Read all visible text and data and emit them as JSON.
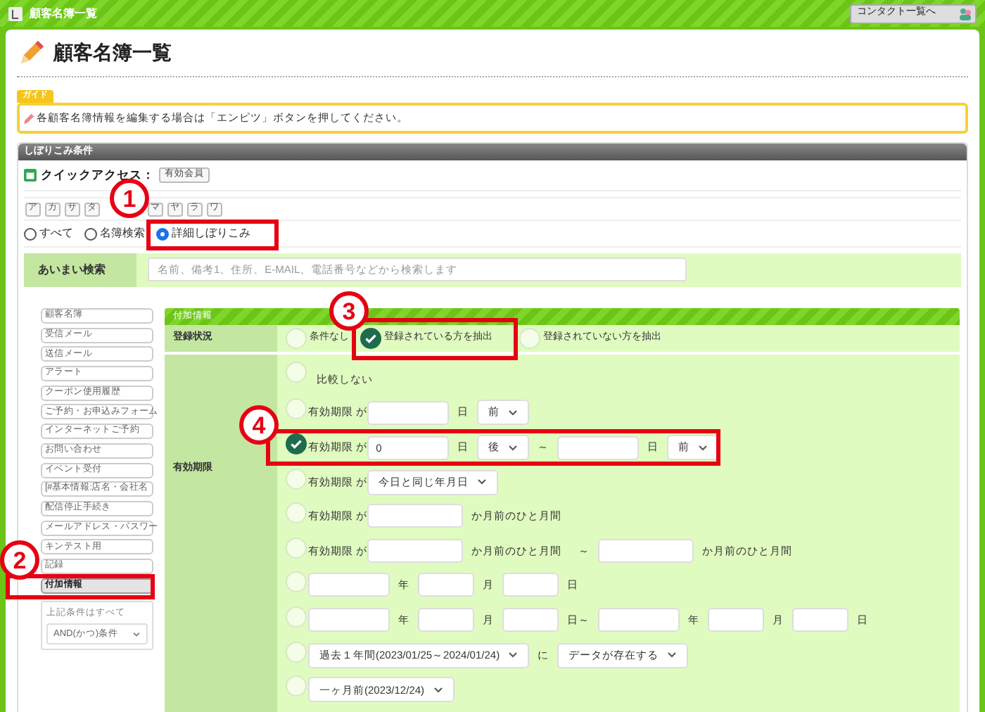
{
  "window": {
    "title": "顧客名簿一覧",
    "contact_button": "コンタクト一覧へ"
  },
  "heading": "顧客名簿一覧",
  "guide": {
    "tag": "ガイド",
    "text": "各顧客名簿情報を編集する場合は「エンピツ」ボタンを押してください。"
  },
  "filter": {
    "title": "しぼりこみ条件",
    "quick_access_label": "クイックアクセス：",
    "quick_access_buttons": [
      "有効会員"
    ],
    "kana": [
      "ア",
      "カ",
      "サ",
      "タ",
      "マ",
      "ヤ",
      "ラ",
      "ワ"
    ],
    "modes": [
      {
        "label": "すべて",
        "selected": false
      },
      {
        "label": "名簿検索",
        "selected": false
      },
      {
        "label": "詳細しぼりこみ",
        "selected": true
      }
    ],
    "fuzzy_search": {
      "label": "あいまい検索",
      "placeholder": "名前、備考1、住所、E-MAIL、電話番号などから検索します"
    }
  },
  "sidebar": {
    "items": [
      {
        "label": "顧客名簿",
        "selected": false
      },
      {
        "label": "受信メール",
        "selected": false
      },
      {
        "label": "送信メール",
        "selected": false
      },
      {
        "label": "アラート",
        "selected": false
      },
      {
        "label": "クーポン使用履歴",
        "selected": false
      },
      {
        "label": "ご予約・お申込みフォーム",
        "selected": false
      },
      {
        "label": "インターネットご予約",
        "selected": false
      },
      {
        "label": "お問い合わせ",
        "selected": false
      },
      {
        "label": "イベント受付",
        "selected": false
      },
      {
        "label": "[#基本情報:店名・会社名",
        "selected": false
      },
      {
        "label": "配信停止手続き",
        "selected": false
      },
      {
        "label": "メールアドレス・パスワー",
        "selected": false
      },
      {
        "label": "キンテスト用",
        "selected": false
      },
      {
        "label": "記録",
        "selected": false
      },
      {
        "label": "付加情報",
        "selected": true
      }
    ],
    "combine_label": "上記条件はすべて",
    "combine_select": "AND(かつ)条件"
  },
  "panel": {
    "title": "付加情報",
    "registration": {
      "label": "登録状況",
      "options": [
        {
          "label": "条件なし",
          "selected": false
        },
        {
          "label": "登録されている方を抽出",
          "selected": true
        },
        {
          "label": "登録されていない方を抽出",
          "selected": false
        }
      ]
    },
    "expiry": {
      "label": "有効期限",
      "options": [
        {
          "selected": false,
          "parts": [
            {
              "kind": "text",
              "text": "比較しない"
            }
          ]
        },
        {
          "selected": false,
          "parts": [
            {
              "kind": "label",
              "text": "有効期限 が"
            },
            {
              "kind": "input"
            },
            {
              "kind": "text",
              "text": "日"
            },
            {
              "kind": "select",
              "text": "前"
            }
          ]
        },
        {
          "selected": true,
          "parts": [
            {
              "kind": "label",
              "text": "有効期限 が"
            },
            {
              "kind": "input",
              "value": "0"
            },
            {
              "kind": "text",
              "text": "日"
            },
            {
              "kind": "select",
              "text": "後"
            },
            {
              "kind": "text",
              "text": "～"
            },
            {
              "kind": "input"
            },
            {
              "kind": "text",
              "text": "日"
            },
            {
              "kind": "select",
              "text": "前"
            }
          ]
        },
        {
          "selected": false,
          "parts": [
            {
              "kind": "label",
              "text": "有効期限 が"
            },
            {
              "kind": "select",
              "text": "今日と同じ年月日"
            }
          ]
        },
        {
          "selected": false,
          "parts": [
            {
              "kind": "label",
              "text": "有効期限 が"
            },
            {
              "kind": "wide_input"
            },
            {
              "kind": "text",
              "text": "か月前のひと月間"
            }
          ]
        },
        {
          "selected": false,
          "parts": [
            {
              "kind": "label",
              "text": "有効期限 が"
            },
            {
              "kind": "wide_input"
            },
            {
              "kind": "text",
              "text": "か月前のひと月間"
            },
            {
              "kind": "text",
              "text": "～"
            },
            {
              "kind": "wide_input"
            },
            {
              "kind": "text",
              "text": "か月前のひと月間"
            }
          ]
        },
        {
          "selected": false,
          "parts": [
            {
              "kind": "year_input"
            },
            {
              "kind": "text",
              "text": "年"
            },
            {
              "kind": "small_input"
            },
            {
              "kind": "text",
              "text": "月"
            },
            {
              "kind": "small_input"
            },
            {
              "kind": "text",
              "text": "日"
            }
          ]
        },
        {
          "selected": false,
          "parts": [
            {
              "kind": "year_input"
            },
            {
              "kind": "text",
              "text": "年"
            },
            {
              "kind": "small_input"
            },
            {
              "kind": "text",
              "text": "月"
            },
            {
              "kind": "small_input"
            },
            {
              "kind": "text",
              "text": "日～"
            },
            {
              "kind": "year_input"
            },
            {
              "kind": "text",
              "text": "年"
            },
            {
              "kind": "small_input"
            },
            {
              "kind": "text",
              "text": "月"
            },
            {
              "kind": "small_input"
            },
            {
              "kind": "text",
              "text": "日"
            }
          ]
        },
        {
          "selected": false,
          "parts": [
            {
              "kind": "select",
              "text": "過去１年間(2023/01/25～2024/01/24)"
            },
            {
              "kind": "text",
              "text": "に"
            },
            {
              "kind": "select",
              "text": "データが存在する"
            }
          ]
        },
        {
          "selected": false,
          "parts": [
            {
              "kind": "select",
              "text": "一ヶ月前(2023/12/24)"
            }
          ]
        }
      ]
    }
  },
  "callouts": [
    {
      "number": "1"
    },
    {
      "number": "2"
    },
    {
      "number": "3"
    },
    {
      "number": "4"
    }
  ]
}
